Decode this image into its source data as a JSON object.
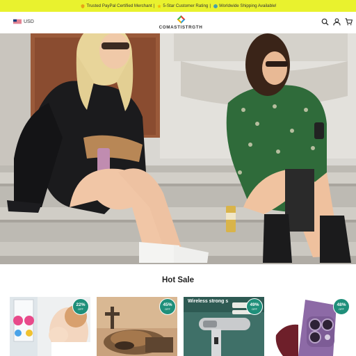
{
  "announcement": {
    "text": "Trusted PayPal Certified Merchant | ⭐ 5-Star Customer Rating | 🌍 Worldwide Shipping Available!",
    "segments": [
      "Trusted PayPal Certified Merchant",
      "5-Star Customer Rating",
      "Worldwide Shipping Available!"
    ],
    "separator": "|"
  },
  "header": {
    "currency": "USD",
    "logo_text": "COMASTISTRGTH",
    "icons": [
      "search-icon",
      "user-icon",
      "cart-icon"
    ]
  },
  "hero": {
    "image": "two women sitting on stone steps"
  },
  "hot_sale": {
    "title": "Hot Sale",
    "products": [
      {
        "discount": "22%",
        "off_label": "OFF"
      },
      {
        "discount": "45%",
        "off_label": "OFF"
      },
      {
        "discount": "49%",
        "off_label": "OFF",
        "image_text": "Wireless strong s"
      },
      {
        "discount": "48%",
        "off_label": "OFF"
      }
    ]
  },
  "colors": {
    "announcement_bg": "#e9f22e",
    "badge_bg": "#1f8f7a"
  }
}
